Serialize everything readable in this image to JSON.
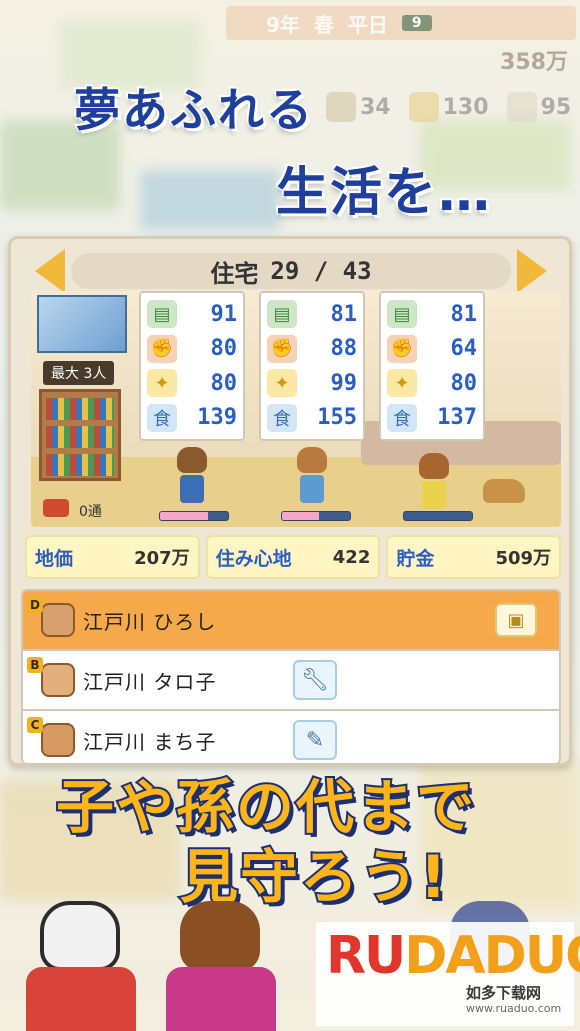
{
  "hud": {
    "year": "9年",
    "season": "春",
    "day_type": "平日",
    "weather_count": "9",
    "money": "358万",
    "stats": [
      {
        "icon": "book-icon",
        "value": "34"
      },
      {
        "icon": "music-note-icon",
        "value": "130"
      },
      {
        "icon": "tv-icon",
        "value": "95"
      }
    ]
  },
  "headline": {
    "line1": "夢あふれる",
    "line2": "生活を…",
    "line3": "子や孫の代まで",
    "line4": "見守ろう!"
  },
  "panel": {
    "title": "住宅",
    "count": "29 / 43",
    "capacity": "最大 3人",
    "mail": "0通",
    "residents": [
      {
        "stats": [
          "91",
          "80",
          "80",
          "139"
        ],
        "bar": 0.7
      },
      {
        "stats": [
          "81",
          "88",
          "99",
          "155"
        ],
        "bar": 0.55
      },
      {
        "stats": [
          "81",
          "64",
          "80",
          "137"
        ],
        "bar": 0.0
      }
    ],
    "summary": [
      {
        "label": "地価",
        "value": "207万"
      },
      {
        "label": "住み心地",
        "value": "422"
      },
      {
        "label": "貯金",
        "value": "509万"
      }
    ],
    "family": [
      {
        "rank": "D",
        "name": "江戸川 ひろし",
        "action": "role-card-icon",
        "selected": true
      },
      {
        "rank": "B",
        "name": "江戸川 タロ子",
        "action": "wrench-icon",
        "selected": false
      },
      {
        "rank": "C",
        "name": "江戸川 まち子",
        "action": "pencil-icon",
        "selected": false
      }
    ]
  },
  "watermark": {
    "brand_left": "RU",
    "brand_right": "DADUO",
    "line1": "如多下载网",
    "line2": "www.ruaduo.com"
  },
  "colors": {
    "headline_blue": "#1e3f9c",
    "headline_orange": "#ffb51a",
    "stat_blue": "#2a5fc2",
    "selected_row": "#f6a94a"
  }
}
